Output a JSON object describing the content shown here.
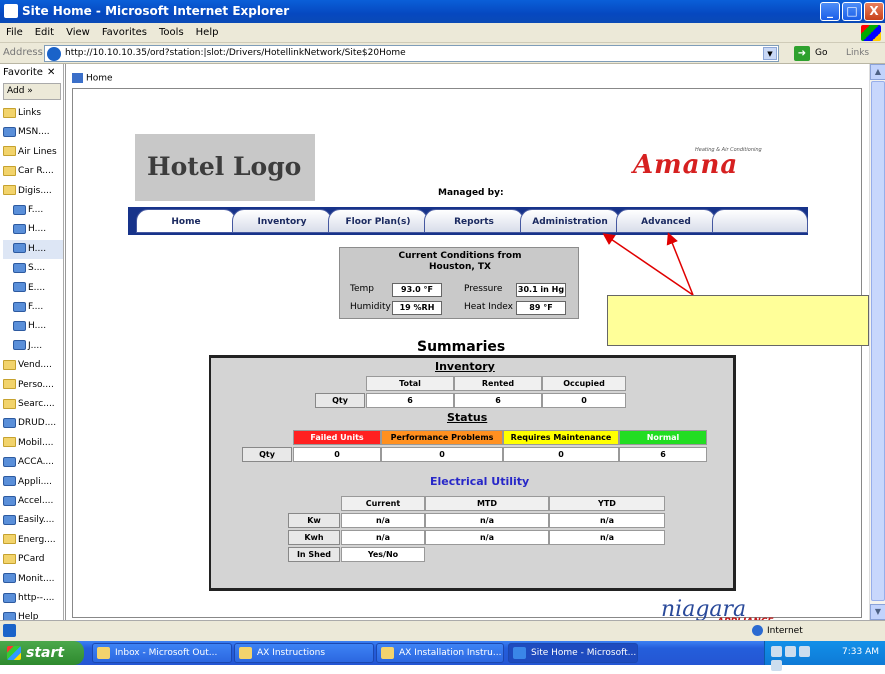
{
  "window": {
    "title": "Site Home - Microsoft Internet Explorer",
    "minimize": "_",
    "maximize": "□",
    "close": "X"
  },
  "menu": [
    "File",
    "Edit",
    "View",
    "Favorites",
    "Tools",
    "Help"
  ],
  "address": {
    "label": "Address",
    "url": "http://10.10.10.35/ord?station:|slot:/Drivers/HotellinkNetwork/Site$20Home",
    "go": "Go",
    "links": "Links"
  },
  "favorites": {
    "header": "Favorite",
    "add_label": "Add",
    "items": [
      {
        "label": "Links",
        "type": "folder",
        "sub": false
      },
      {
        "label": "MSN....",
        "type": "page",
        "sub": false
      },
      {
        "label": "Air Lines",
        "type": "folder",
        "sub": false
      },
      {
        "label": "Car R....",
        "type": "folder",
        "sub": false
      },
      {
        "label": "Digis....",
        "type": "folder",
        "sub": false
      },
      {
        "label": "F....",
        "type": "page",
        "sub": true
      },
      {
        "label": "H....",
        "type": "page",
        "sub": true
      },
      {
        "label": "H....",
        "type": "page",
        "sub": true
      },
      {
        "label": "S....",
        "type": "page",
        "sub": true
      },
      {
        "label": "E....",
        "type": "page",
        "sub": true
      },
      {
        "label": "F....",
        "type": "page",
        "sub": true
      },
      {
        "label": "H....",
        "type": "page",
        "sub": true
      },
      {
        "label": "J....",
        "type": "page",
        "sub": true
      },
      {
        "label": "Vend....",
        "type": "folder",
        "sub": false
      },
      {
        "label": "Perso....",
        "type": "folder",
        "sub": false
      },
      {
        "label": "Searc....",
        "type": "folder",
        "sub": false
      },
      {
        "label": "DRUD....",
        "type": "page",
        "sub": false
      },
      {
        "label": "Mobil....",
        "type": "folder",
        "sub": false
      },
      {
        "label": "ACCA....",
        "type": "page",
        "sub": false
      },
      {
        "label": "Appli....",
        "type": "page",
        "sub": false
      },
      {
        "label": "Accel....",
        "type": "page",
        "sub": false
      },
      {
        "label": "Easily....",
        "type": "page",
        "sub": false
      },
      {
        "label": "Energ....",
        "type": "folder",
        "sub": false
      },
      {
        "label": "PCard",
        "type": "folder",
        "sub": false
      },
      {
        "label": "Monit....",
        "type": "page",
        "sub": false
      },
      {
        "label": "http--....",
        "type": "page",
        "sub": false
      },
      {
        "label": "Help",
        "type": "page",
        "sub": false
      }
    ]
  },
  "breadcrumb": "Home",
  "page": {
    "logo_text": "Hotel Logo",
    "brand_sub": "Heating & Air Conditioning",
    "brand_word": "Amana",
    "managed_by": "Managed by:",
    "tabs": [
      "Home",
      "Inventory",
      "Floor Plan(s)",
      "Reports",
      "Administration",
      "Advanced",
      ""
    ],
    "conditions": {
      "title_line1": "Current Conditions from",
      "title_line2": "Houston, TX",
      "temp_label": "Temp",
      "temp_value": "93.0 °F",
      "pressure_label": "Pressure",
      "pressure_value": "30.1 in Hg",
      "humidity_label": "Humidity",
      "humidity_value": "19 %RH",
      "heat_index_label": "Heat Index",
      "heat_index_value": "89 °F"
    },
    "summaries_title": "Summaries",
    "inventory": {
      "title": "Inventory",
      "headers": [
        "Total",
        "Rented",
        "Occupied"
      ],
      "row_label": "Qty",
      "values": [
        "6",
        "6",
        "0"
      ]
    },
    "status": {
      "title": "Status",
      "headers": [
        "Failed Units",
        "Performance Problems",
        "Requires Maintenance",
        "Normal"
      ],
      "header_colors": [
        "#ff2020",
        "#ff9020",
        "#ffff00",
        "#22dd22"
      ],
      "row_label": "Qty",
      "values": [
        "0",
        "0",
        "0",
        "6"
      ]
    },
    "electrical": {
      "title": "Electrical Utility",
      "headers": [
        "Current",
        "MTD",
        "YTD"
      ],
      "rows": [
        {
          "label": "Kw",
          "values": [
            "n/a",
            "n/a",
            "n/a"
          ]
        },
        {
          "label": "Kwh",
          "values": [
            "n/a",
            "n/a",
            "n/a"
          ]
        },
        {
          "label": "In Shed",
          "values": [
            "Yes/No"
          ]
        }
      ]
    },
    "niagara_word": "niagara",
    "niagara_sub": "APPLIANCE"
  },
  "status_bar": {
    "zone": "Internet"
  },
  "taskbar": {
    "start": "start",
    "tasks": [
      "Inbox - Microsoft Out...",
      "AX Instructions",
      "AX Installation Instru...",
      "Site Home - Microsoft..."
    ],
    "clock": "7:33 AM"
  },
  "colors": {
    "nav": "#17338a",
    "callout": "#ffff99",
    "arrow": "#e00000"
  }
}
